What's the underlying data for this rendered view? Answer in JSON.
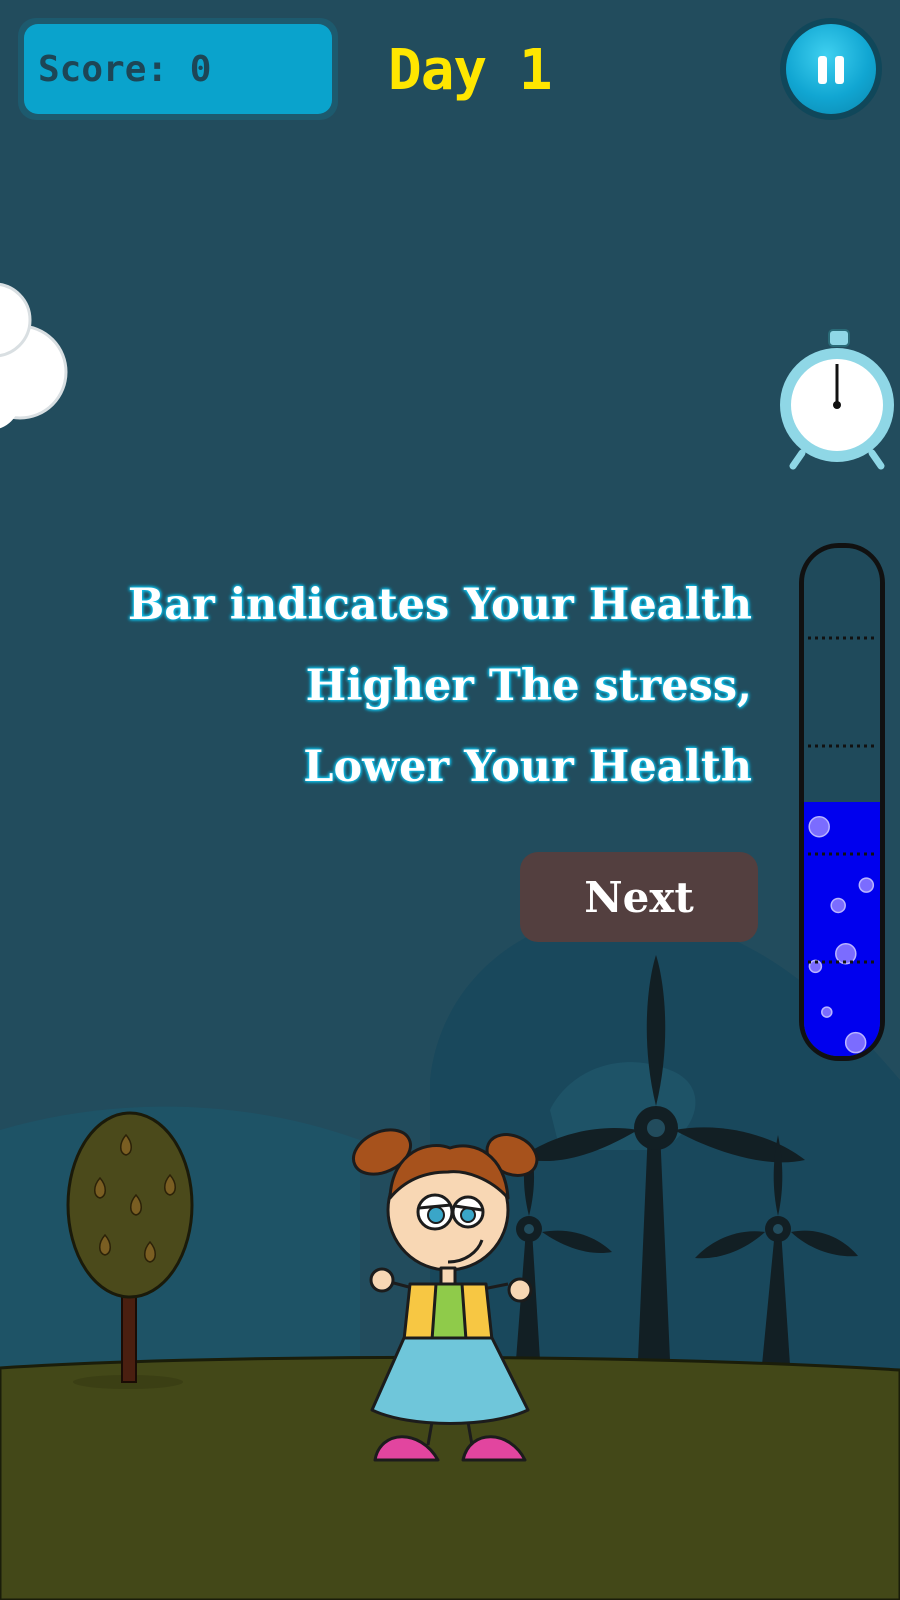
{
  "hud": {
    "score_label": "Score: 0",
    "day_label": "Day 1"
  },
  "tutorial": {
    "lines": [
      "Bar indicates Your Health",
      "Higher The stress,",
      "Lower Your Health"
    ],
    "next_label": "Next"
  },
  "health_bar": {
    "level": 0.5,
    "fill_color": "#0000ee"
  },
  "colors": {
    "sky": "#224c5d",
    "score_panel": "#0aa3cc",
    "day_text": "#ffe600",
    "ground": "#434818",
    "next_button": "#533f3f",
    "text_glow": "#0cc6f2"
  },
  "icons": [
    "pause-icon",
    "alarm-clock-icon",
    "cloud-icon",
    "wind-turbine-icon",
    "tree-icon",
    "girl-character"
  ]
}
